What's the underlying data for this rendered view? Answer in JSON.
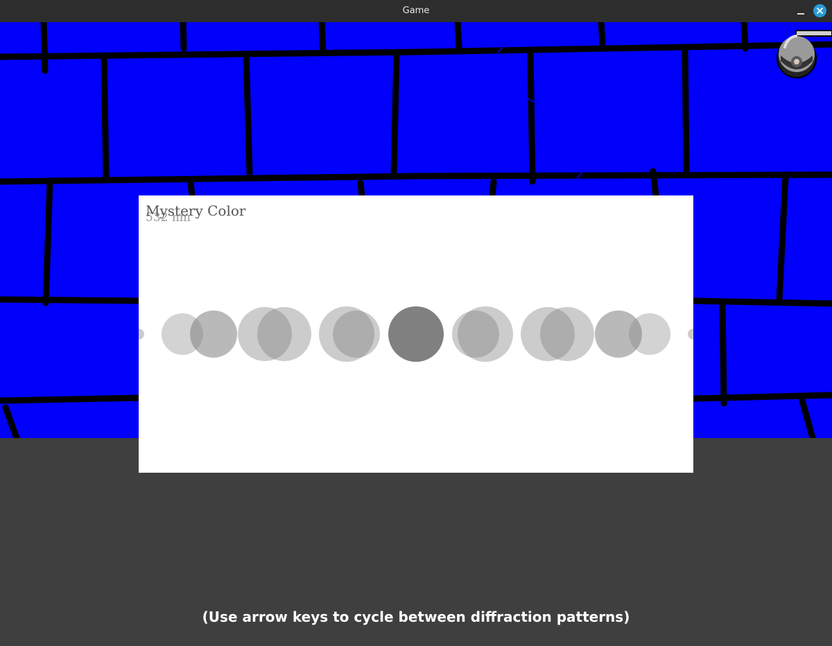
{
  "window": {
    "title": "Game"
  },
  "card": {
    "title": "Mystery Color",
    "subtitle": "532 nm"
  },
  "hint": "(Use arrow keys to cycle between diffraction patterns)",
  "colors": {
    "wall": "#0000fb",
    "grout": "#000000",
    "card": "#ffffff",
    "dot": "#808080",
    "floor": "#3f3f3f"
  },
  "icons": [
    "minimize-icon",
    "close-icon",
    "security-camera-icon"
  ]
}
